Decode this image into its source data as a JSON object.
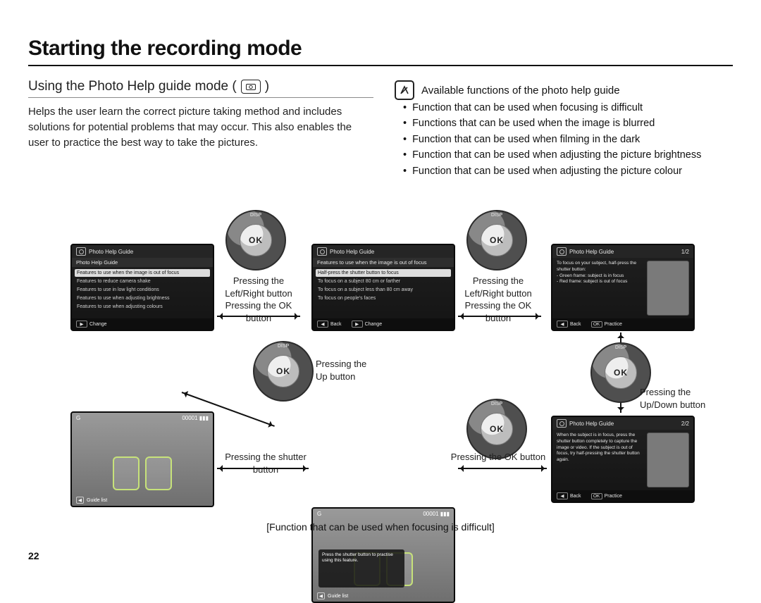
{
  "page_number": "22",
  "title": "Starting the recording mode",
  "section": {
    "heading_prefix": "Using the Photo Help guide mode ( ",
    "heading_suffix": " )",
    "paragraph": "Helps the user learn the correct picture taking method and includes solutions for potential problems that may occur. This also enables the user to practice the best way to take the pictures."
  },
  "note": {
    "heading": "Available functions of the photo help guide",
    "bullets": [
      "Function that can be used when focusing is difficult",
      "Functions that can be used when the image is blurred",
      "Function that can be used when filming in the dark",
      "Function that can be used when adjusting the picture brightness",
      "Function that can be used when adjusting the picture colour"
    ]
  },
  "dial": {
    "center": "OK",
    "top": "DISP"
  },
  "captions": {
    "lr_ok_1": "Pressing the\nLeft/Right button\nPressing the OK button",
    "lr_ok_2": "Pressing the\nLeft/Right button\nPressing the OK button",
    "up": "Pressing the\nUp button",
    "updown": "Pressing the\nUp/Down button",
    "shutter": "Pressing the shutter button",
    "ok": "Pressing the OK button"
  },
  "lcd": {
    "header": "Photo Help Guide",
    "crumb": "Photo Help Guide",
    "page_1": "1/2",
    "page_2": "2/2",
    "foot": {
      "change_key": "▶",
      "change": "Change",
      "back_key": "◀",
      "back": "Back",
      "ok_key": "OK",
      "practice": "Practice"
    },
    "menu1": {
      "sel": "Features to use when the image is out of focus",
      "items": [
        "Features to reduce camera shake",
        "Features to use in low light conditions",
        "Features to use when adjusting brightness",
        "Features to use when adjusting colours"
      ]
    },
    "menu2": {
      "sel": "Half-press the shutter button to focus",
      "items": [
        "To focus on a subject 80 cm or farther",
        "To focus on a subject less than 80 cm away",
        "To focus on people's faces"
      ]
    },
    "detail1": {
      "text": "To focus on your subject, half-press the shutter button:\n- Green frame: subject is in focus\n- Red frame: subject is out of focus"
    },
    "detail2": {
      "text": "When the subject is in focus, press the shutter button completely to capture the image or video. If the subject is out of focus, try half-pressing the shutter button again."
    }
  },
  "photo": {
    "top_left": "G",
    "top_right": "00001  ▮▮▮",
    "guide_key": "◀",
    "guide_label": "Guide list",
    "tip": "Press the shutter button to practise using this feature."
  },
  "footnote": "[Function that can be used when focusing is difficult]"
}
